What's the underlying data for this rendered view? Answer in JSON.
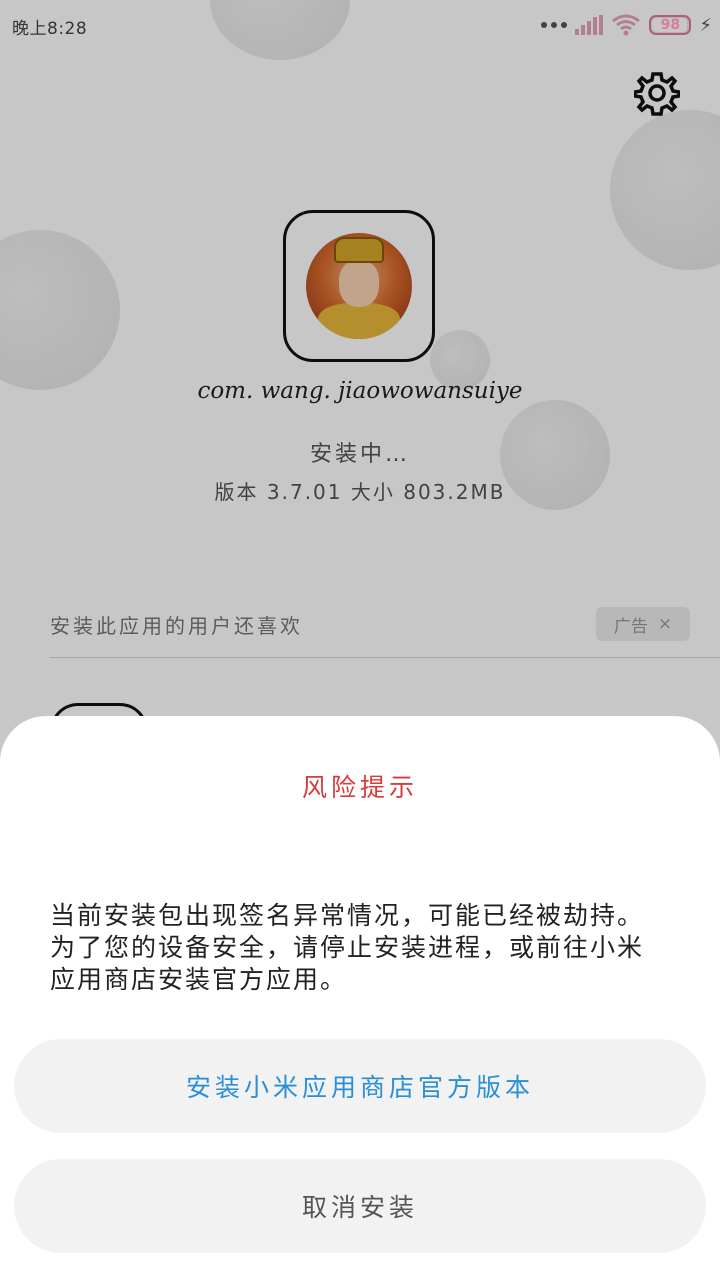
{
  "status_bar": {
    "time": "晚上8:28",
    "battery": "98",
    "icons": [
      "dots-icon",
      "signal-icon",
      "wifi-icon",
      "battery-icon",
      "charging-icon"
    ]
  },
  "header": {
    "settings_icon": "gear-icon"
  },
  "app": {
    "package_name": "com. wang. jiaowowansuiye",
    "status": "安装中…",
    "version_info": "版本 3.7.01 大小 803.2MB"
  },
  "recommendations": {
    "title": "安装此应用的用户还喜欢",
    "ad_label": "广告",
    "ad_close": "×"
  },
  "dialog": {
    "title": "风险提示",
    "message": "当前安装包出现签名异常情况，可能已经被劫持。为了您的设备安全，请停止安装进程，或前往小米应用商店安装官方应用。",
    "primary_button": "安装小米应用商店官方版本",
    "cancel_button": "取消安装"
  },
  "colors": {
    "title_red": "#d83b3b",
    "link_blue": "#2a8fd6",
    "button_bg": "#f2f2f2",
    "battery_pink": "#d87d99"
  }
}
